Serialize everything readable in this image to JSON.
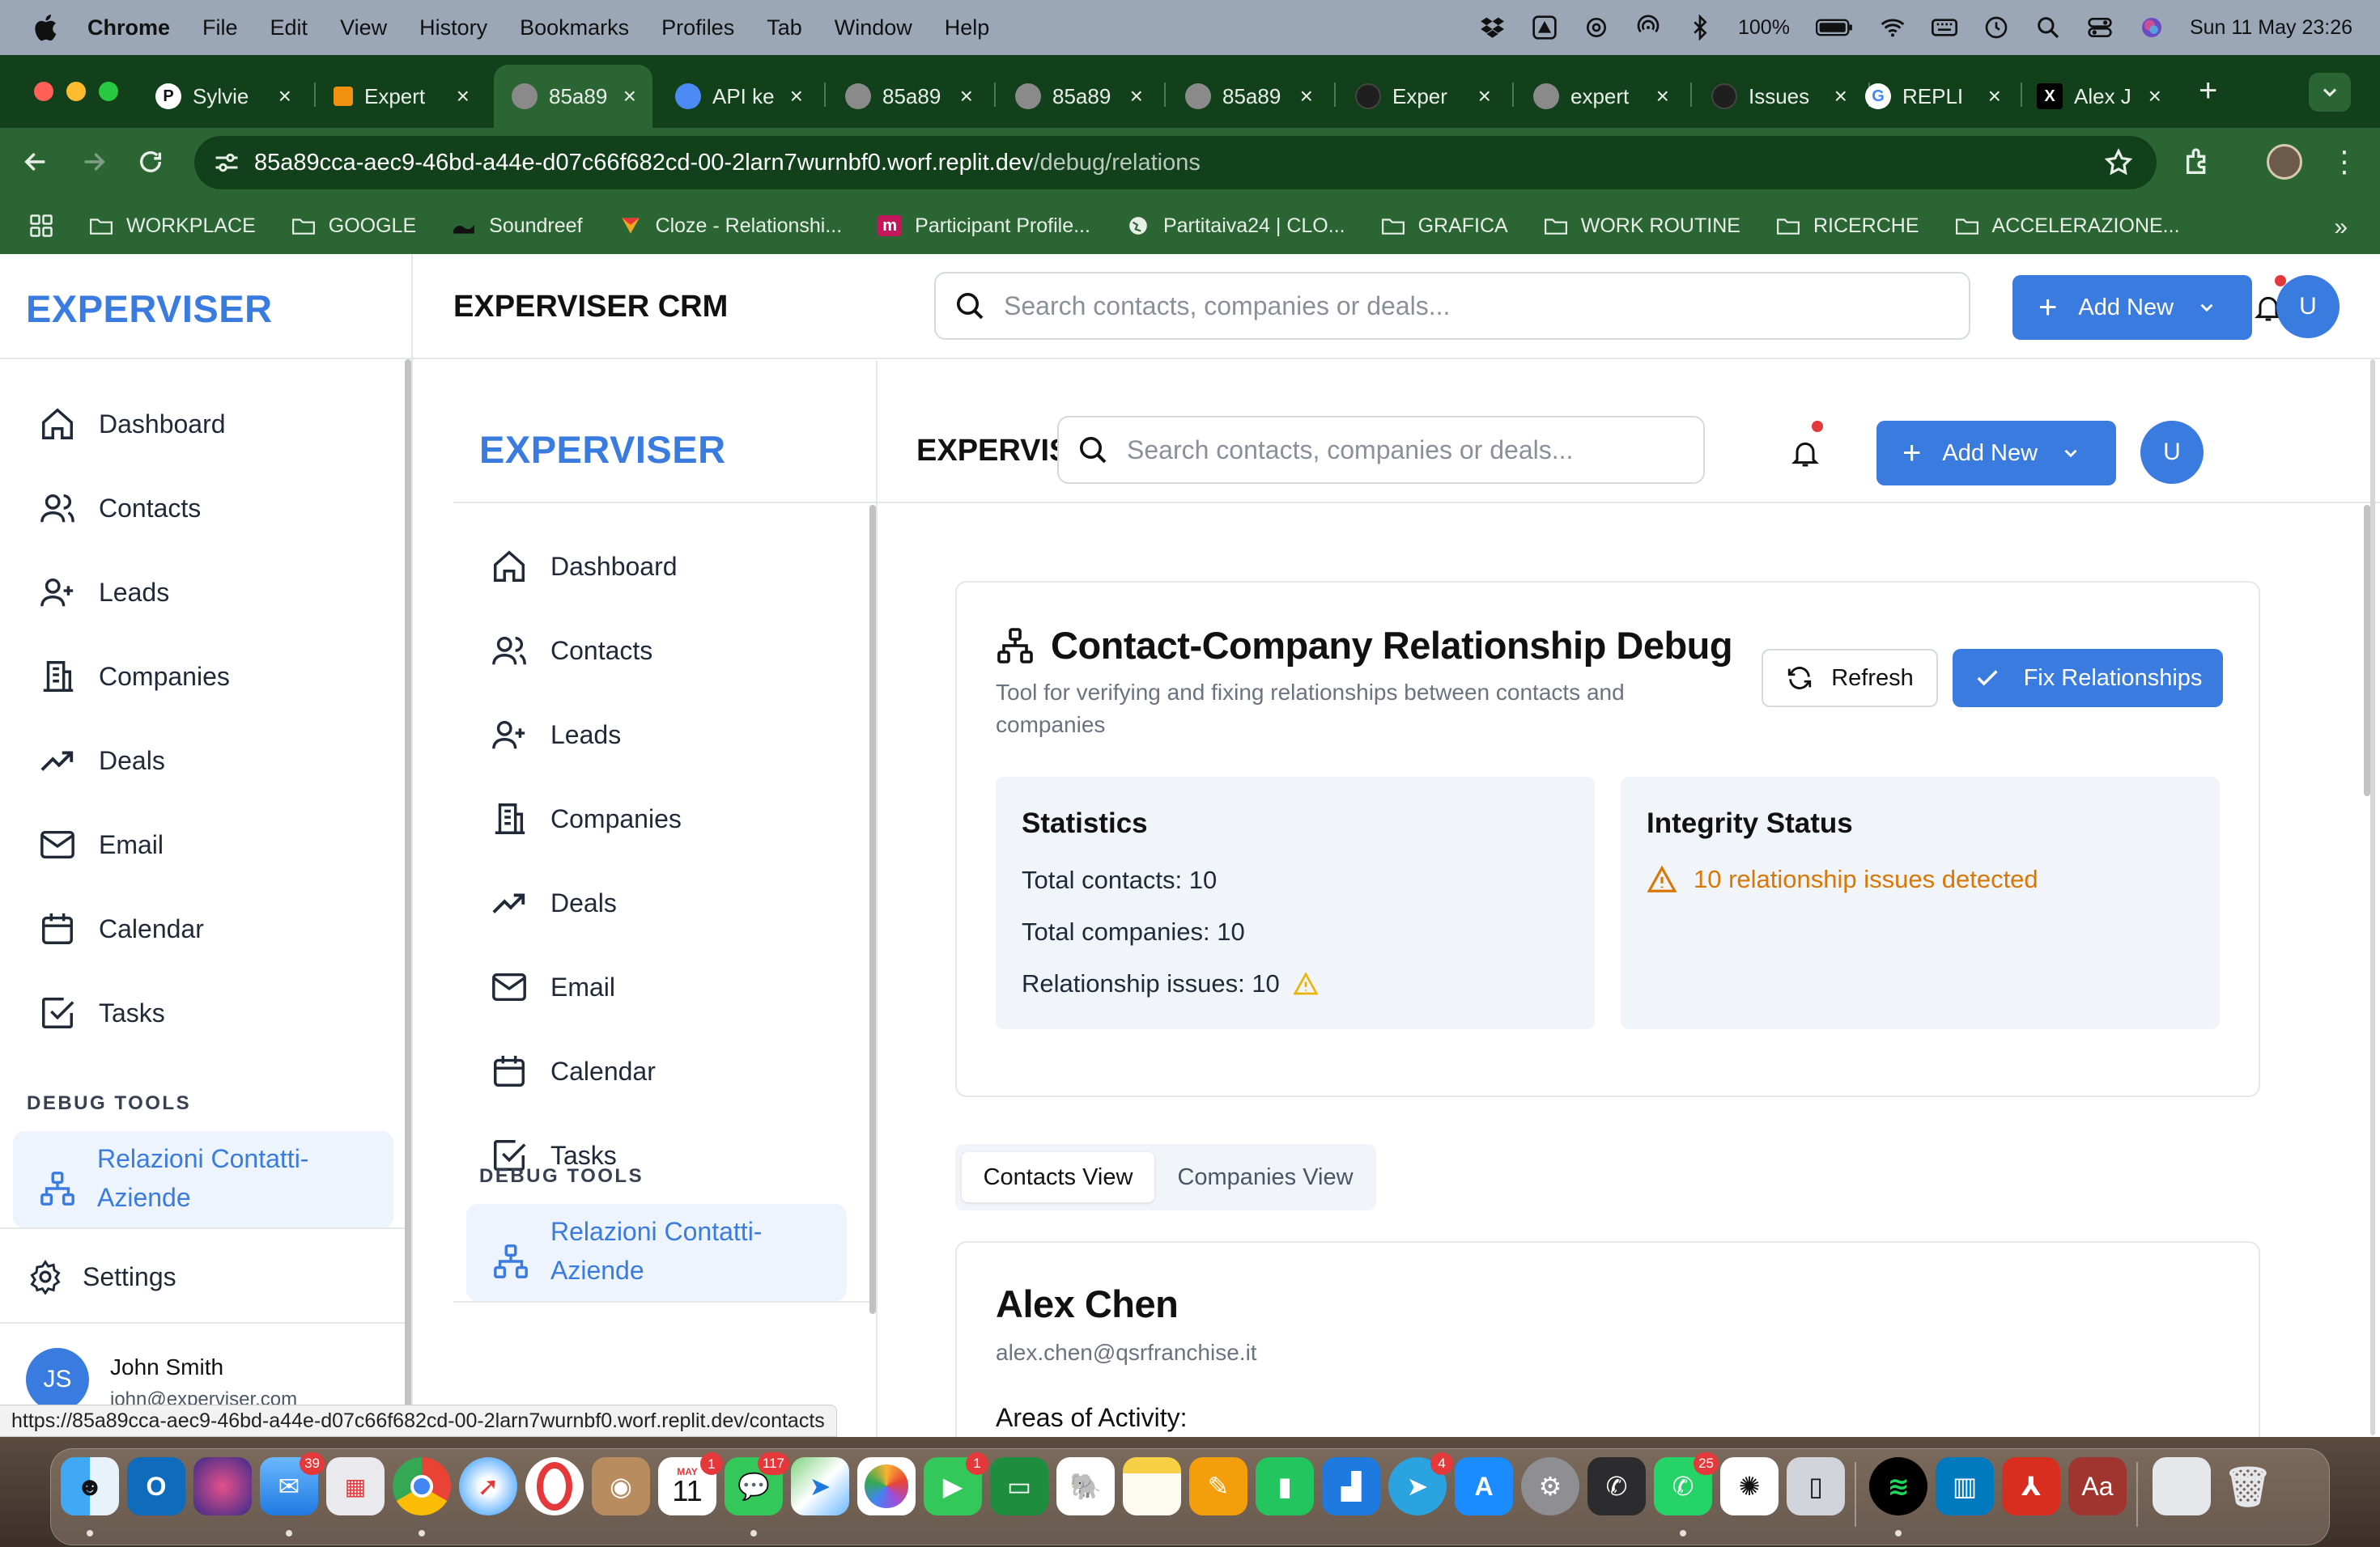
{
  "menubar": {
    "app_name": "Chrome",
    "menus": [
      "File",
      "Edit",
      "View",
      "History",
      "Bookmarks",
      "Profiles",
      "Tab",
      "Window",
      "Help"
    ],
    "battery": "100%",
    "datetime": "Sun 11 May  23:26"
  },
  "browser": {
    "tabs": [
      {
        "label": "Sylvie",
        "favicon_text": "P",
        "favicon_color": "#ffffff"
      },
      {
        "label": "Expert",
        "favicon_text": "",
        "favicon_color": "#f29111"
      },
      {
        "label": "85a89",
        "favicon_text": "",
        "favicon_color": "#8a8a8a"
      },
      {
        "label": "API ke",
        "favicon_text": "",
        "favicon_color": "#4c8bf5"
      },
      {
        "label": "85a89",
        "favicon_text": "",
        "favicon_color": "#8a8a8a"
      },
      {
        "label": "85a89",
        "favicon_text": "",
        "favicon_color": "#8a8a8a"
      },
      {
        "label": "85a89",
        "favicon_text": "",
        "favicon_color": "#8a8a8a"
      },
      {
        "label": "Exper",
        "favicon_text": "",
        "favicon_color": "#1f1f1f"
      },
      {
        "label": "expert",
        "favicon_text": "",
        "favicon_color": "#8a8a8a"
      },
      {
        "label": "Issues",
        "favicon_text": "",
        "favicon_color": "#1f1f1f"
      },
      {
        "label": "REPLI",
        "favicon_text": "G",
        "favicon_color": "#ffffff"
      },
      {
        "label": "Alex J",
        "favicon_text": "X",
        "favicon_color": "#000000"
      }
    ],
    "url_host": "85a89cca-aec9-46bd-a44e-d07c66f682cd-00-2larn7wurnbf0.worf.replit.dev",
    "url_path": "/debug/relations",
    "bookmarks": [
      "WORKPLACE",
      "GOOGLE",
      "Soundreef",
      "Cloze - Relationshi...",
      "Participant Profile...",
      "Partitaiva24 | CLO...",
      "GRAFICA",
      "WORK ROUTINE",
      "RICERCHE",
      "ACCELERAZIONE..."
    ],
    "status_url": "https://85a89cca-aec9-46bd-a44e-d07c66f682cd-00-2larn7wurnbf0.worf.replit.dev/contacts"
  },
  "app": {
    "logo": "EXPERVISER",
    "crm_title": "EXPERVISER CRM",
    "search_placeholder": "Search contacts, companies or deals...",
    "add_new_label": "Add New",
    "avatar_initial": "U",
    "nav": [
      {
        "label": "Dashboard",
        "icon": "home-icon"
      },
      {
        "label": "Contacts",
        "icon": "users-icon"
      },
      {
        "label": "Leads",
        "icon": "user-plus-icon"
      },
      {
        "label": "Companies",
        "icon": "building-icon"
      },
      {
        "label": "Deals",
        "icon": "trending-up-icon"
      },
      {
        "label": "Email",
        "icon": "mail-icon"
      },
      {
        "label": "Calendar",
        "icon": "calendar-icon"
      },
      {
        "label": "Tasks",
        "icon": "check-square-icon"
      }
    ],
    "debug_section_label": "DEBUG TOOLS",
    "debug_item_line1": "Relazioni Contatti-",
    "debug_item_line2": "Aziende",
    "settings_label": "Settings",
    "user": {
      "initials": "JS",
      "name": "John Smith",
      "email": "john@experviser.com"
    }
  },
  "debug": {
    "title": "Contact-Company Relationship Debug",
    "subtitle": "Tool for verifying and fixing relationships between contacts and companies",
    "refresh_label": "Refresh",
    "fix_label": "Fix Relationships",
    "statistics": {
      "heading": "Statistics",
      "total_contacts": "Total contacts: 10",
      "total_companies": "Total companies: 10",
      "relationship_issues": "Relationship issues: 10"
    },
    "integrity": {
      "heading": "Integrity Status",
      "message": "10 relationship issues detected"
    },
    "view_tabs": [
      "Contacts View",
      "Companies View"
    ],
    "active_view": "Contacts View",
    "contact": {
      "name": "Alex Chen",
      "email": "alex.chen@qsrfranchise.it",
      "areas_label": "Areas of Activity:"
    }
  },
  "colors": {
    "accent": "#3a7be0",
    "warning": "#d97706",
    "browser_frame": "#2b6534"
  },
  "dock": {
    "badges": {
      "mail": "39",
      "calendar": "1",
      "messages": "117",
      "facetime": "1",
      "telegram": "4",
      "whatsapp": "25"
    },
    "calendar_month": "MAY",
    "calendar_day": "11"
  }
}
